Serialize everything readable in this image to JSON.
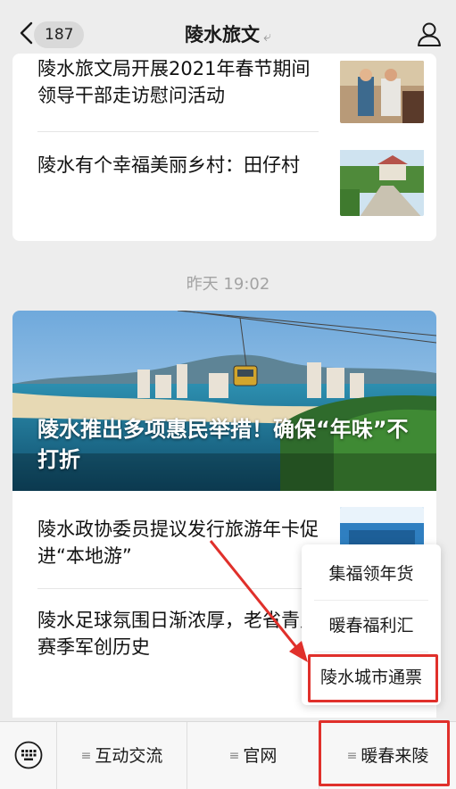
{
  "header": {
    "back_icon": "chevron-left-icon",
    "unread_count": "187",
    "title": "陵水旅文",
    "ear_icon": "ear-icon",
    "profile_icon": "person-icon"
  },
  "articles_group1": [
    {
      "title": "陵水旅文局开展2021年春节期间领导干部走访慰问活动"
    },
    {
      "title": "陵水有个幸福美丽乡村：田仔村"
    }
  ],
  "timestamp": "昨天 19:02",
  "articles_group2": {
    "hero_title": "陵水推出多项惠民举措！确保“年味”不打折",
    "items": [
      {
        "title": "陵水政协委员提议发行旅游年卡促进“本地游”"
      },
      {
        "title": "陵水足球氛围日渐浓厚，老省青足赛季军创历史"
      }
    ]
  },
  "submenu": {
    "items": [
      "集福领年货",
      "暖春福利汇",
      "陵水城市通票"
    ]
  },
  "menubar": {
    "keyboard_icon": "keyboard-icon",
    "items": [
      "互动交流",
      "官网",
      "暖春来陵"
    ]
  },
  "colors": {
    "highlight": "#e0302b",
    "background": "#ededed"
  }
}
